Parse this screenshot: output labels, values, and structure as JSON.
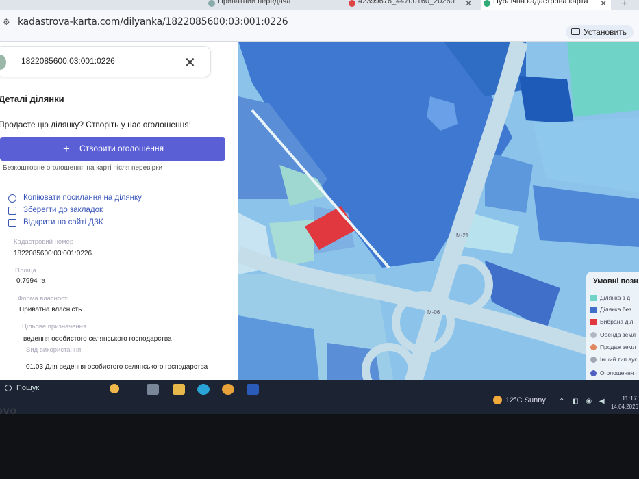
{
  "browser": {
    "tabs": [
      {
        "label": "Приватний передача"
      },
      {
        "label": "42399676_44700160_20260"
      },
      {
        "label": "Публічна кадастрова карта",
        "active": true
      }
    ],
    "new_tab": "+",
    "url": "kadastrova-karta.com/dilyanka/1822085600:03:001:0226",
    "install_label": "Установить"
  },
  "sidebar": {
    "search_value": "1822085600:03:001:0226",
    "details_title": "Деталі ділянки",
    "sell_prompt": "Продаєте цю ділянку? Створіть у нас оголошення!",
    "create_button": "Створити оголошення",
    "free_note": "Безкоштовне оголошення на карті після перевірки",
    "actions": [
      {
        "label": "Копіювати посилання на ділянку",
        "icon": "copy-icon"
      },
      {
        "label": "Зберегти до закладок",
        "icon": "bookmark-icon"
      },
      {
        "label": "Відкрити на сайті ДЗК",
        "icon": "external-link-icon"
      }
    ],
    "fields": {
      "cadastral_label": "Кадастровий номер",
      "cadastral_value": "1822085600:03:001:0226",
      "area_label": "Площа",
      "area_value": "0.7994 га",
      "ownership_label": "Форма власності",
      "ownership_value": "Приватна власність",
      "purpose_label": "Цільове призначення",
      "purpose_value": "ведення особистого селянського господарства",
      "use_label": "Вид використання",
      "use_value": "01.03 Для ведення особистого селянського господарства"
    }
  },
  "map": {
    "road_labels": [
      "М-21",
      "М-06"
    ],
    "legend": {
      "title": "Умовні позн",
      "items": [
        {
          "label": "Ділянка з д",
          "color": "#6fd3c8"
        },
        {
          "label": "Ділянка без",
          "color": "#3f6fc8"
        },
        {
          "label": "Вибрана діл",
          "color": "#e0383e"
        },
        {
          "label": "Оренда земл",
          "color": "#b0b8c4"
        },
        {
          "label": "Продаж земл",
          "color": "#e08860"
        },
        {
          "label": "Інший тип аук",
          "color": "#a0a8b4"
        },
        {
          "label": "Оголошення п",
          "color": "#5060c0"
        }
      ]
    },
    "colors": {
      "selected": "#e0383e",
      "owned": "#6fd3c8",
      "unregistered": "#3f6fc8"
    }
  },
  "taskbar": {
    "search_label": "Пошук",
    "weather": "12°C  Sunny",
    "time": "11:17",
    "date": "14.04.2026"
  },
  "device": {
    "brand": "ovo"
  }
}
